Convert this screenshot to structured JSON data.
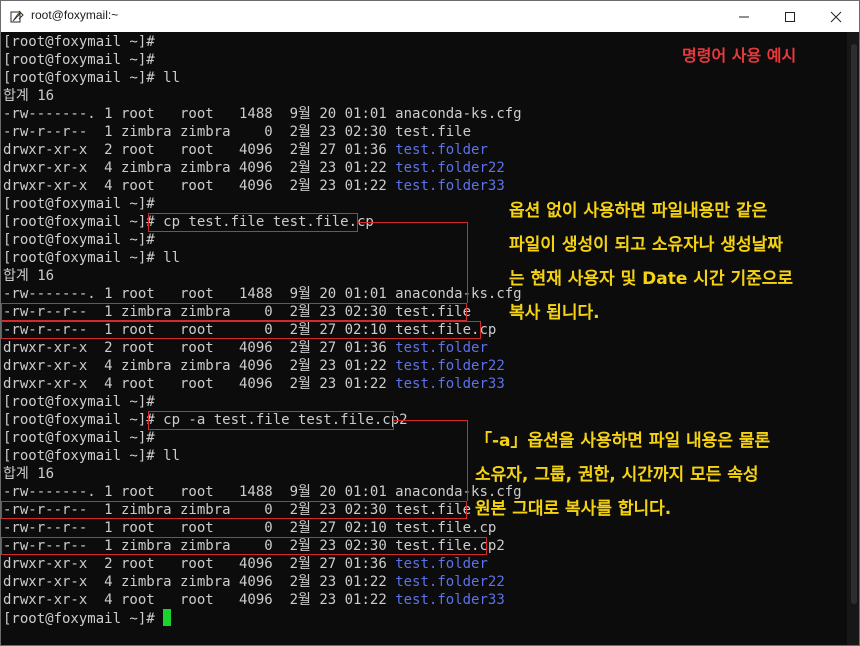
{
  "window": {
    "title": "root@foxymail:~",
    "buttons": {
      "minimize": "minimize",
      "maximize": "maximize",
      "close": "close"
    }
  },
  "header_note": "명령어 사용 예시",
  "terminal": {
    "lines": [
      {
        "segs": [
          {
            "t": "[root@foxymail ~]#",
            "c": "f"
          }
        ]
      },
      {
        "segs": [
          {
            "t": "[root@foxymail ~]#",
            "c": "f"
          }
        ]
      },
      {
        "segs": [
          {
            "t": "[root@foxymail ~]# ll",
            "c": "f"
          }
        ]
      },
      {
        "segs": [
          {
            "t": "합계 16",
            "c": "f"
          }
        ]
      },
      {
        "segs": [
          {
            "t": "-rw-------. 1 root   root   1488  9월 20 01:01 anaconda-ks.cfg",
            "c": "f"
          }
        ]
      },
      {
        "segs": [
          {
            "t": "-rw-r--r--  1 zimbra zimbra    0  2월 23 02:30 test.file",
            "c": "f"
          }
        ]
      },
      {
        "segs": [
          {
            "t": "drwxr-xr-x  2 root   root   4096  2월 27 01:36 ",
            "c": "f"
          },
          {
            "t": "test.folder",
            "c": "dir"
          }
        ]
      },
      {
        "segs": [
          {
            "t": "drwxr-xr-x  4 zimbra zimbra 4096  2월 23 01:22 ",
            "c": "f"
          },
          {
            "t": "test.folder22",
            "c": "dir"
          }
        ]
      },
      {
        "segs": [
          {
            "t": "drwxr-xr-x  4 root   root   4096  2월 23 01:22 ",
            "c": "f"
          },
          {
            "t": "test.folder33",
            "c": "dir"
          }
        ]
      },
      {
        "segs": [
          {
            "t": "[root@foxymail ~]#",
            "c": "f"
          }
        ]
      },
      {
        "segs": [
          {
            "t": "[root@foxymail ~]# cp test.file test.file.cp",
            "c": "f"
          }
        ]
      },
      {
        "segs": [
          {
            "t": "[root@foxymail ~]#",
            "c": "f"
          }
        ]
      },
      {
        "segs": [
          {
            "t": "[root@foxymail ~]# ll",
            "c": "f"
          }
        ]
      },
      {
        "segs": [
          {
            "t": "합계 16",
            "c": "f"
          }
        ]
      },
      {
        "segs": [
          {
            "t": "-rw-------. 1 root   root   1488  9월 20 01:01 anaconda-ks.cfg",
            "c": "f"
          }
        ]
      },
      {
        "segs": [
          {
            "t": "-rw-r--r--  1 zimbra zimbra    0  2월 23 02:30 test.file",
            "c": "f"
          }
        ]
      },
      {
        "segs": [
          {
            "t": "-rw-r--r--  1 root   root      0  2월 27 02:10 test.file.cp",
            "c": "f"
          }
        ]
      },
      {
        "segs": [
          {
            "t": "drwxr-xr-x  2 root   root   4096  2월 27 01:36 ",
            "c": "f"
          },
          {
            "t": "test.folder",
            "c": "dir"
          }
        ]
      },
      {
        "segs": [
          {
            "t": "drwxr-xr-x  4 zimbra zimbra 4096  2월 23 01:22 ",
            "c": "f"
          },
          {
            "t": "test.folder22",
            "c": "dir"
          }
        ]
      },
      {
        "segs": [
          {
            "t": "drwxr-xr-x  4 root   root   4096  2월 23 01:22 ",
            "c": "f"
          },
          {
            "t": "test.folder33",
            "c": "dir"
          }
        ]
      },
      {
        "segs": [
          {
            "t": "[root@foxymail ~]#",
            "c": "f"
          }
        ]
      },
      {
        "segs": [
          {
            "t": "[root@foxymail ~]# cp -a test.file test.file.cp2",
            "c": "f"
          }
        ]
      },
      {
        "segs": [
          {
            "t": "[root@foxymail ~]#",
            "c": "f"
          }
        ]
      },
      {
        "segs": [
          {
            "t": "[root@foxymail ~]# ll",
            "c": "f"
          }
        ]
      },
      {
        "segs": [
          {
            "t": "합계 16",
            "c": "f"
          }
        ]
      },
      {
        "segs": [
          {
            "t": "-rw-------. 1 root   root   1488  9월 20 01:01 anaconda-ks.cfg",
            "c": "f"
          }
        ]
      },
      {
        "segs": [
          {
            "t": "-rw-r--r--  1 zimbra zimbra    0  2월 23 02:30 test.file",
            "c": "f"
          }
        ]
      },
      {
        "segs": [
          {
            "t": "-rw-r--r--  1 root   root      0  2월 27 02:10 test.file.cp",
            "c": "f"
          }
        ]
      },
      {
        "segs": [
          {
            "t": "-rw-r--r--  1 zimbra zimbra    0  2월 23 02:30 test.file.cp2",
            "c": "f"
          }
        ]
      },
      {
        "segs": [
          {
            "t": "drwxr-xr-x  2 root   root   4096  2월 27 01:36 ",
            "c": "f"
          },
          {
            "t": "test.folder",
            "c": "dir"
          }
        ]
      },
      {
        "segs": [
          {
            "t": "drwxr-xr-x  4 zimbra zimbra 4096  2월 23 01:22 ",
            "c": "f"
          },
          {
            "t": "test.folder22",
            "c": "dir"
          }
        ]
      },
      {
        "segs": [
          {
            "t": "drwxr-xr-x  4 root   root   4096  2월 23 01:22 ",
            "c": "f"
          },
          {
            "t": "test.folder33",
            "c": "dir"
          }
        ]
      },
      {
        "segs": [
          {
            "t": "[root@foxymail ~]# ",
            "c": "f"
          }
        ],
        "cursor": true
      }
    ]
  },
  "annotation_cp": [
    "옵션 없이 사용하면 파일내용만 같은",
    "파일이 생성이 되고 소유자나 생성날짜",
    "는 현재 사용자 및 Date 시간 기준으로",
    "복사 됩니다."
  ],
  "annotation_cp_a": [
    "「-a」옵션을 사용하면 파일 내용은 물론",
    "소유자, 그룹, 권한, 시간까지 모든 속성",
    "원본 그대로 복사를 합니다."
  ],
  "colors": {
    "terminal_bg": "#0c0c0c",
    "text": "#cccccc",
    "directory": "#5d72e8",
    "cursor": "#1ad32d",
    "highlight": "#d62a2a",
    "annotation": "#f5d312",
    "header_note": "#e8393c"
  }
}
